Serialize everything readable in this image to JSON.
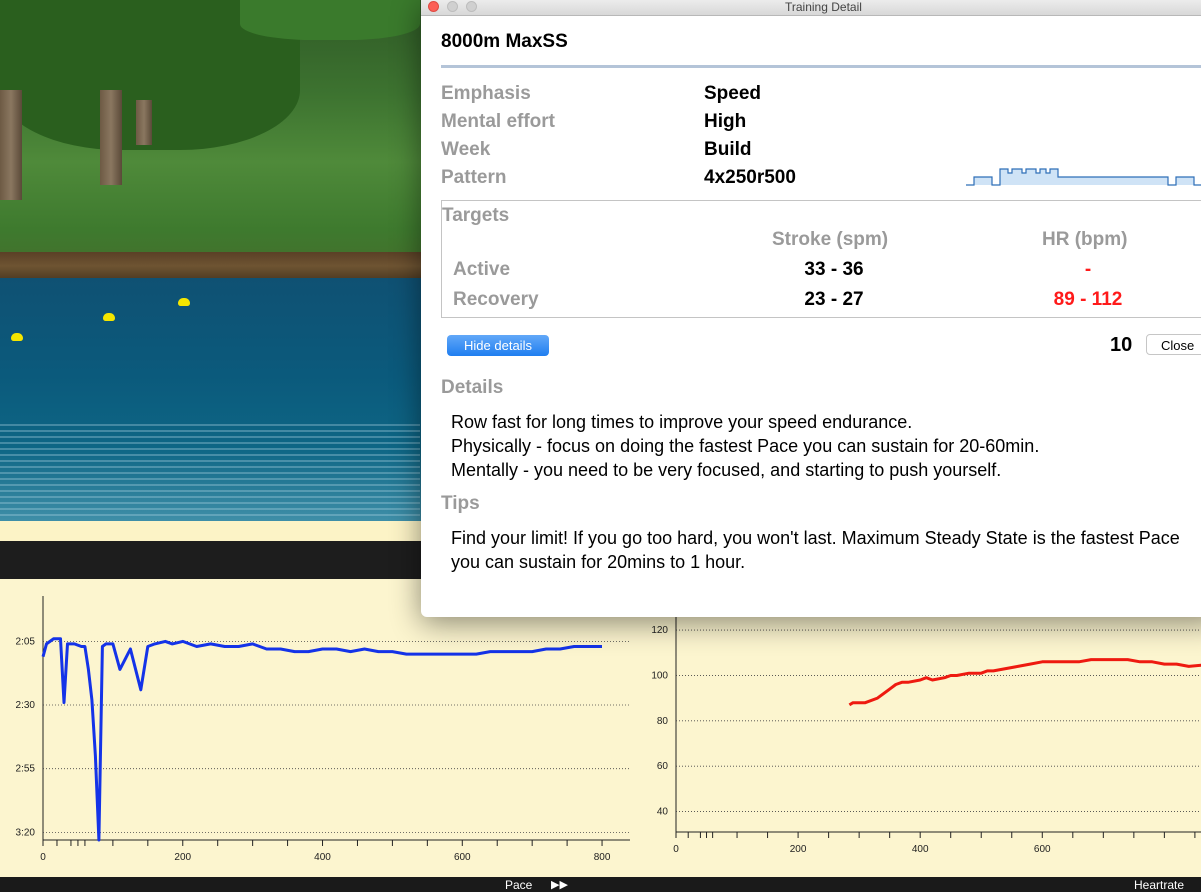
{
  "window": {
    "title": "Training Detail"
  },
  "workout": {
    "title": "8000m MaxSS",
    "fields": [
      {
        "label": "Emphasis",
        "value": "Speed"
      },
      {
        "label": "Mental effort",
        "value": "High"
      },
      {
        "label": "Week",
        "value": "Build"
      },
      {
        "label": "Pattern",
        "value": "4x250r500"
      }
    ]
  },
  "targets": {
    "heading": "Targets",
    "columns": [
      "Stroke (spm)",
      "HR (bpm)"
    ],
    "rows": [
      {
        "label": "Active",
        "stroke": "33 - 36",
        "hr": "-"
      },
      {
        "label": "Recovery",
        "stroke": "23 - 27",
        "hr": "89 - 112"
      }
    ],
    "hr_color": "#ff1a1a"
  },
  "controls": {
    "hide_details": "Hide details",
    "count": "10",
    "close": "Close"
  },
  "details": {
    "heading": "Details",
    "lines": [
      "Row fast for long times to improve your speed endurance.",
      "Physically - focus on doing the fastest Pace you can sustain for 20-60min.",
      "Mentally - you need to be very focused, and starting to push yourself."
    ]
  },
  "tips": {
    "heading": "Tips",
    "text": "Find your limit!  If you go too hard, you won't last.  Maximum Steady State is the fastest Pace you can sustain for 20mins to 1 hour."
  },
  "bottom_bar": {
    "left_label": "Pace",
    "right_label": "Heartrate",
    "forward_icon": "fast-forward-icon"
  },
  "chart_data": [
    {
      "type": "line",
      "name": "Pace",
      "color": "#1433e8",
      "y_ticks": [
        "2:05",
        "2:30",
        "2:55",
        "3:20"
      ],
      "y_tick_seconds": [
        125,
        150,
        175,
        200
      ],
      "x_ticks": [
        0,
        200,
        400,
        600,
        800
      ],
      "xlim": [
        0,
        840
      ],
      "ylim_seconds": [
        117,
        203
      ],
      "y_inverted": true,
      "grid": "horizontal dotted",
      "x": [
        0,
        5,
        10,
        15,
        20,
        25,
        30,
        35,
        40,
        45,
        55,
        60,
        65,
        70,
        75,
        80,
        85,
        90,
        100,
        110,
        125,
        140,
        150,
        160,
        175,
        185,
        200,
        220,
        240,
        260,
        280,
        300,
        320,
        340,
        360,
        380,
        400,
        420,
        440,
        460,
        480,
        500,
        520,
        540,
        560,
        580,
        600,
        620,
        640,
        660,
        680,
        700,
        720,
        740,
        760,
        780,
        800
      ],
      "y_seconds": [
        131,
        126,
        125,
        124,
        124,
        124,
        149,
        126,
        126,
        126,
        127,
        127,
        136,
        148,
        170,
        203,
        127,
        126,
        126,
        136,
        128,
        144,
        127,
        126,
        125,
        126,
        125,
        127,
        126,
        127,
        127,
        126,
        128,
        128,
        129,
        129,
        128,
        128,
        129,
        128,
        129,
        129,
        130,
        130,
        130,
        130,
        130,
        130,
        129,
        129,
        129,
        129,
        128,
        128,
        127,
        127,
        127
      ]
    },
    {
      "type": "line",
      "name": "Heartrate",
      "color": "#ee1a10",
      "y_ticks": [
        40,
        60,
        80,
        100,
        120
      ],
      "x_ticks": [
        0,
        200,
        400,
        600
      ],
      "xlim": [
        0,
        860
      ],
      "ylim": [
        31,
        124
      ],
      "grid": "horizontal dotted",
      "x": [
        284,
        290,
        300,
        310,
        330,
        350,
        360,
        370,
        380,
        400,
        410,
        420,
        440,
        450,
        460,
        480,
        500,
        510,
        520,
        540,
        560,
        580,
        600,
        620,
        640,
        660,
        680,
        700,
        720,
        740,
        760,
        780,
        800,
        810,
        820,
        840,
        880
      ],
      "y": [
        87,
        88,
        88,
        88,
        90,
        94,
        96,
        97,
        97,
        98,
        99,
        98,
        99,
        100,
        100,
        101,
        101,
        102,
        102,
        103,
        104,
        105,
        106,
        106,
        106,
        106,
        107,
        107,
        107,
        107,
        106,
        106,
        105,
        105,
        105,
        104,
        105
      ]
    }
  ]
}
